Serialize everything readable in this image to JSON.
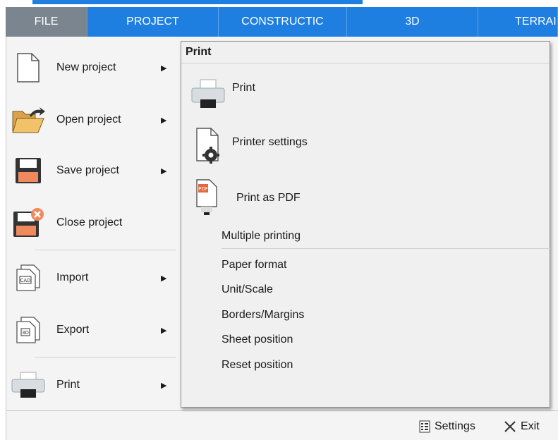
{
  "ribbon": {
    "tabs": [
      {
        "label": "FILE",
        "active": true
      },
      {
        "label": "PROJECT",
        "active": false
      },
      {
        "label": "CONSTRUCTIC",
        "active": false
      },
      {
        "label": "3D",
        "active": false
      },
      {
        "label": "TERRAI",
        "active": false
      }
    ],
    "color": "#1e7fe0",
    "active_color": "#7a8590"
  },
  "menu": {
    "items": [
      {
        "label": "New project",
        "icon": "new-document-icon",
        "has_submenu": true
      },
      {
        "label": "Open project",
        "icon": "open-folder-icon",
        "has_submenu": true
      },
      {
        "label": "Save project",
        "icon": "save-floppy-icon",
        "has_submenu": true
      },
      {
        "label": "Close project",
        "icon": "close-floppy-icon",
        "has_submenu": false
      },
      {
        "label": "Import",
        "icon": "import-cad-icon",
        "has_submenu": true
      },
      {
        "label": "Export",
        "icon": "export-3d-icon",
        "has_submenu": true
      },
      {
        "label": "Print",
        "icon": "printer-icon",
        "has_submenu": true
      }
    ]
  },
  "submenu": {
    "title": "Print",
    "icon_items": [
      {
        "label": "Print",
        "icon": "printer-icon"
      },
      {
        "label": "Printer settings",
        "icon": "printer-settings-gear-icon"
      },
      {
        "label": "Print as PDF",
        "icon": "pdf-print-icon"
      }
    ],
    "text_items": [
      "Multiple printing",
      "Paper format",
      "Unit/Scale",
      "Borders/Margins",
      "Sheet position",
      "Reset position"
    ]
  },
  "footer": {
    "settings_label": "Settings",
    "exit_label": "Exit"
  }
}
